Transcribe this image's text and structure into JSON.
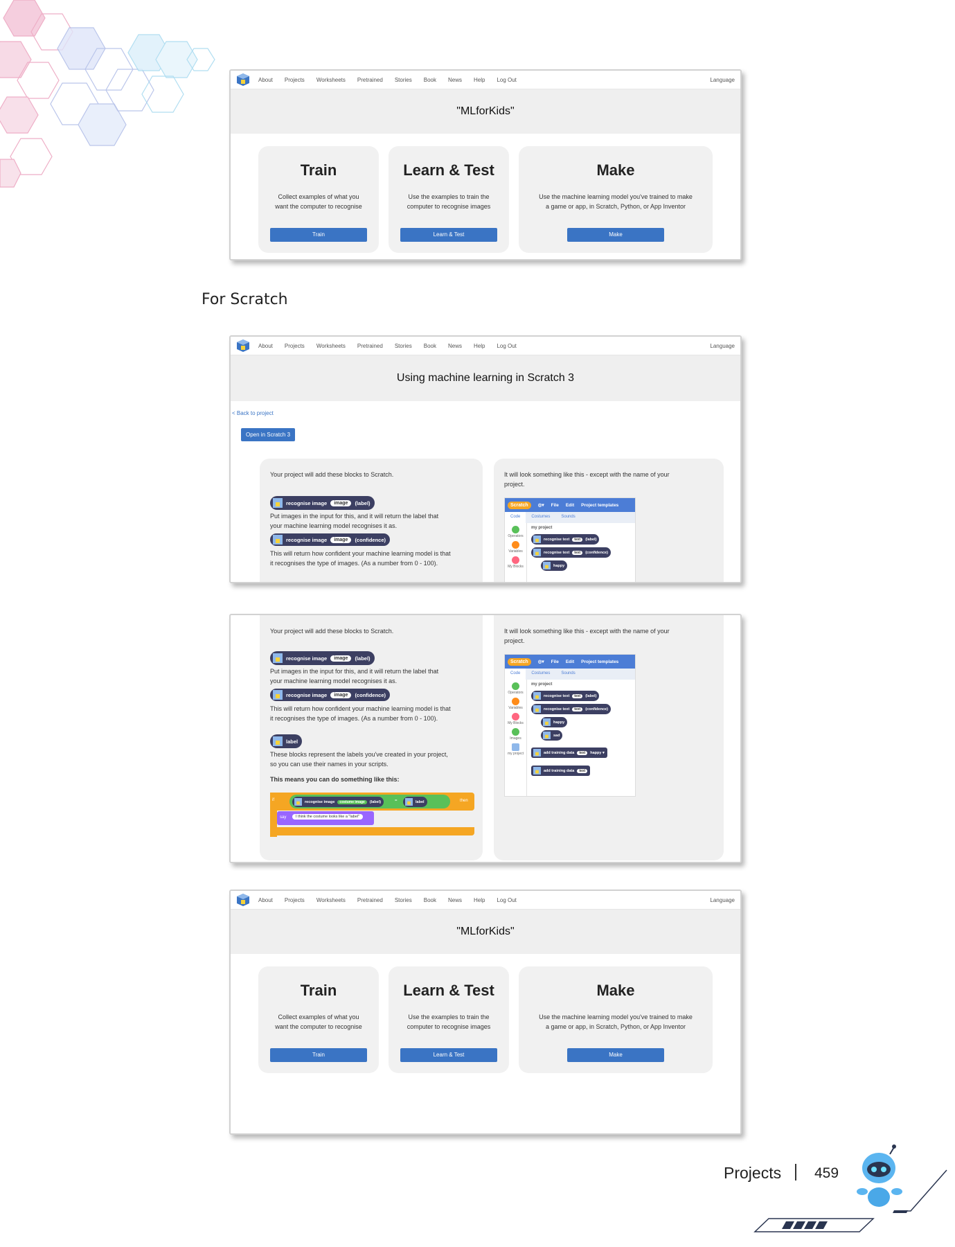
{
  "nav": {
    "items": [
      "About",
      "Projects",
      "Worksheets",
      "Pretrained",
      "Stories",
      "Book",
      "News",
      "Help",
      "Log Out"
    ],
    "language": "Language"
  },
  "home": {
    "title": "\"MLforKids\"",
    "cards": [
      {
        "title": "Train",
        "desc_1": "Collect examples of what you",
        "desc_2": "want the computer to recognise",
        "button": "Train"
      },
      {
        "title": "Learn & Test",
        "desc_1": "Use the examples to train the",
        "desc_2": "computer to recognise images",
        "button": "Learn & Test"
      },
      {
        "title": "Make",
        "desc_1": "Use the machine learning model you've trained to make",
        "desc_2": "a game or app, in Scratch, Python, or App Inventor",
        "button": "Make"
      }
    ]
  },
  "section_heading": "For Scratch",
  "scratch_page": {
    "title": "Using machine learning in Scratch 3",
    "back_link": "< Back to project",
    "open_button": "Open in Scratch 3",
    "left_intro": "Your project will add these blocks to Scratch.",
    "block1": {
      "label": "recognise image",
      "arg": "image",
      "suffix": "(label)"
    },
    "block1_desc_1": "Put images in the input for this, and it will return the label that",
    "block1_desc_2": "your machine learning model recognises it as.",
    "block2": {
      "label": "recognise image",
      "arg": "image",
      "suffix": "(confidence)"
    },
    "block2_desc_1": "This will return how confident your machine learning model is that",
    "block2_desc_2": "it recognises the type of images. (As a number from 0 - 100).",
    "block3": {
      "label": "label"
    },
    "block3_desc_1": "These blocks represent the labels you've created in your project,",
    "block3_desc_2": "so you can use their names in your scripts.",
    "means": "This means you can do something like this:",
    "example": {
      "kw_if": "if",
      "label": "recognise image",
      "arg": "costume image",
      "suffix": "(label)",
      "eq": "=",
      "label_block": "label",
      "kw_then": "then",
      "say": "say",
      "say_text": "I think the costume looks like a \"label\""
    },
    "right_intro_1": "It will look something like this - except with the name of your",
    "right_intro_2": "project.",
    "scratch_ui": {
      "logo": "Scratch",
      "file": "File",
      "edit": "Edit",
      "templates": "Project templates",
      "tab_code": "Code",
      "tab_costumes": "Costumes",
      "tab_sounds": "Sounds",
      "cat_operators": "Operators",
      "cat_variables": "Variables",
      "cat_myblocks": "My Blocks",
      "cat_images": "Images",
      "cat_myproject": "my project",
      "project": "my project",
      "b1": "recognise text",
      "b1_arg": "text",
      "b1_suffix": "(label)",
      "b2": "recognise text",
      "b2_arg": "text",
      "b2_suffix": "(confidence)",
      "b3": "happy",
      "b4": "sad",
      "b5": "add training data",
      "b5_arg": "text",
      "b5_sel": "happy ▾",
      "b6": "add training data",
      "b6_arg": "text"
    }
  },
  "footer": {
    "label": "Projects",
    "page": "459"
  },
  "colors": {
    "button": "#3a74c4",
    "block": "#3c3f62",
    "control": "#f5a623",
    "green": "#59c059",
    "banner": "#efefef"
  }
}
